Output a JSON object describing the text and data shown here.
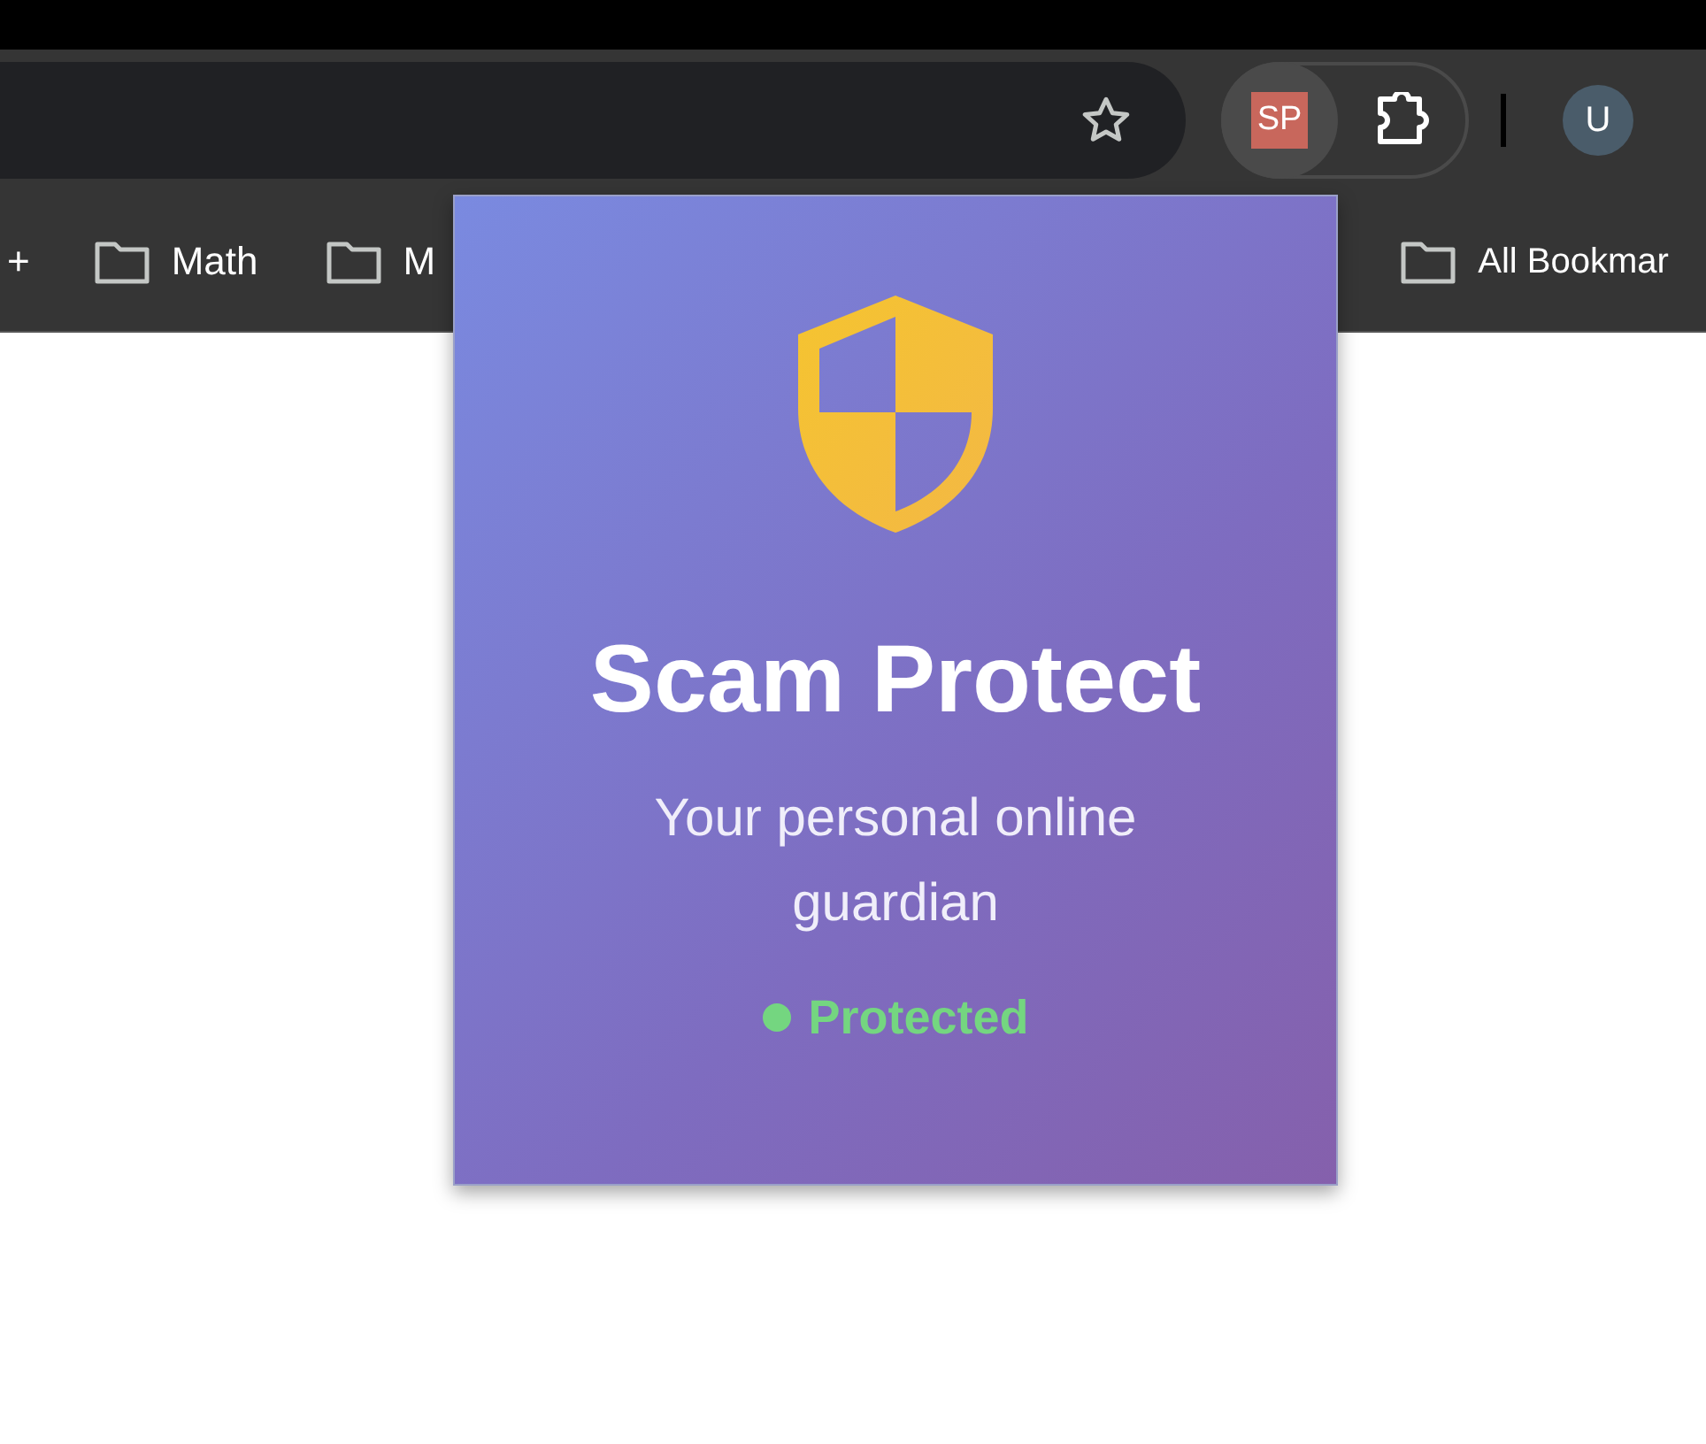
{
  "extensions": [
    {
      "label": "SP",
      "kind": "badge",
      "selected": true
    },
    {
      "kind": "puzzle",
      "selected": false
    }
  ],
  "profile": {
    "initial": "U"
  },
  "bookmarks": [
    {
      "label": "+",
      "kind": "text"
    },
    {
      "label": "Math",
      "kind": "folder"
    },
    {
      "label": "M",
      "kind": "folder"
    },
    {
      "label": "All Bookmar",
      "kind": "folder"
    }
  ],
  "popup": {
    "title": "Scam Protect",
    "subtitle": "Your personal online guardian",
    "status": {
      "label": "Protected",
      "protected": true
    }
  }
}
